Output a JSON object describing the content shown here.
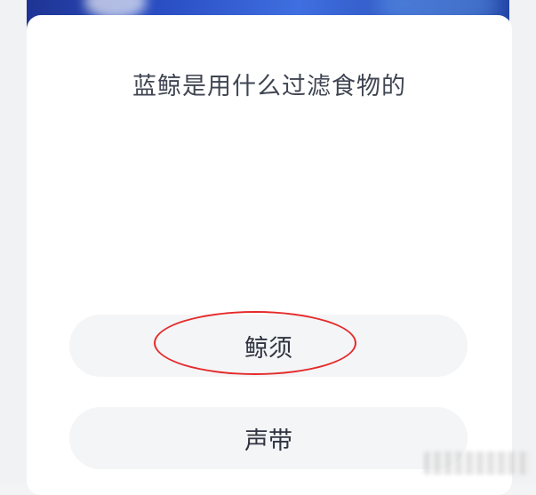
{
  "question": {
    "text": "蓝鲸是用什么过滤食物的"
  },
  "options": [
    {
      "label": "鲸须",
      "highlighted": true
    },
    {
      "label": "声带",
      "highlighted": false
    }
  ],
  "colors": {
    "banner": "#2a4ec4",
    "card": "#ffffff",
    "option_bg": "#f4f5f7",
    "highlight": "#e52a2a",
    "text": "#404552"
  }
}
